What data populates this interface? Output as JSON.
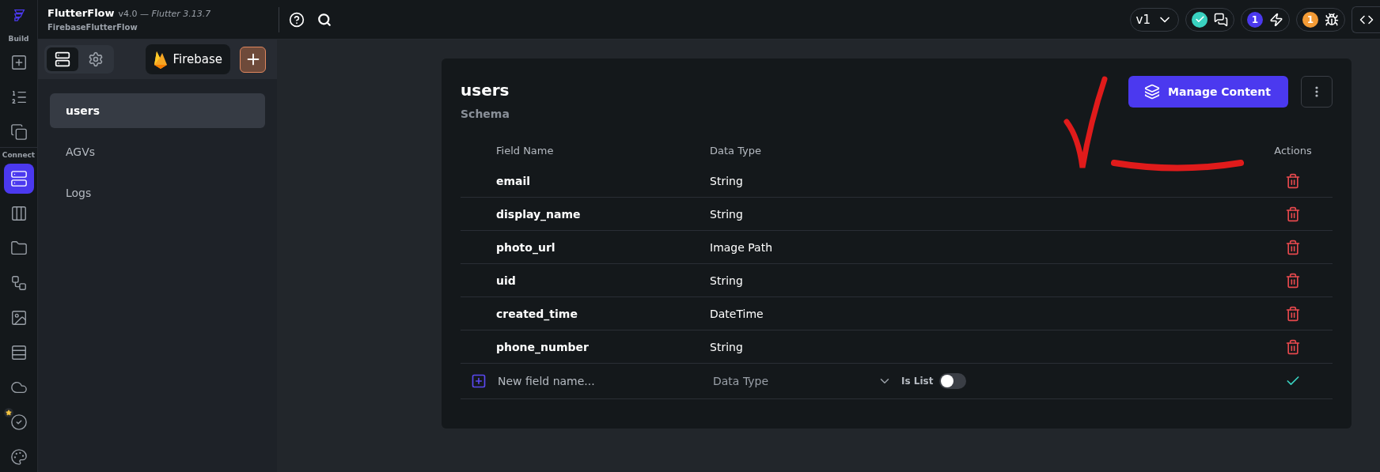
{
  "topbar": {
    "app_name": "FlutterFlow",
    "version": "v4.0 — *Flutter 3.13.7*",
    "project": "FirebaseFlutterFlow",
    "branch": "v1",
    "badges": [
      {
        "kind": "status",
        "color": "#39d2c0"
      },
      {
        "kind": "count",
        "text": "1",
        "color": "#4b39ef"
      },
      {
        "kind": "count",
        "text": "1",
        "color": "#f49b35"
      }
    ]
  },
  "rail": {
    "sections": [
      {
        "label": "Build",
        "items": [
          {
            "selected": false
          },
          {
            "selected": false
          },
          {
            "selected": false
          }
        ]
      },
      {
        "label": "Connect",
        "items": [
          {
            "selected": true
          },
          {
            "selected": false
          },
          {
            "selected": false
          },
          {
            "selected": false
          },
          {
            "selected": false
          },
          {
            "selected": false
          },
          {
            "selected": false
          },
          {
            "selected": false,
            "starred": true
          },
          {
            "selected": false
          }
        ]
      }
    ]
  },
  "panel": {
    "tabs": [
      {
        "selected": true
      },
      {
        "selected": false
      }
    ],
    "source_button": "Firebase",
    "collections": [
      {
        "name": "users",
        "selected": true
      },
      {
        "name": "AGVs",
        "selected": false
      },
      {
        "name": "Logs",
        "selected": false
      }
    ]
  },
  "collection": {
    "title": "users",
    "subtitle": "Schema",
    "action_button": "Manage Content",
    "columns": [
      "Field Name",
      "Data Type",
      "Actions"
    ],
    "fields": [
      {
        "name": "email",
        "type": "String"
      },
      {
        "name": "display_name",
        "type": "String"
      },
      {
        "name": "photo_url",
        "type": "Image Path"
      },
      {
        "name": "uid",
        "type": "String"
      },
      {
        "name": "created_time",
        "type": "DateTime"
      },
      {
        "name": "phone_number",
        "type": "String"
      }
    ],
    "new_field": {
      "placeholder": "New field name...",
      "type_placeholder": "Data Type",
      "list_label": "Is List",
      "is_list": false
    }
  }
}
